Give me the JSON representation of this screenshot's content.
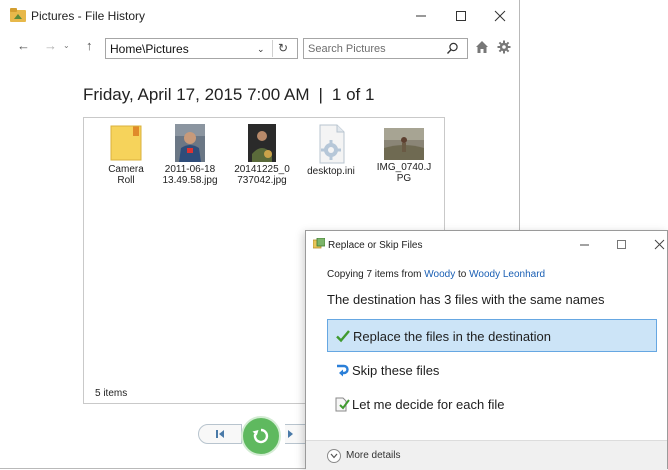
{
  "window": {
    "title": "Pictures - File History",
    "controls": {
      "minimize": "—",
      "maximize": "☐",
      "close": "✕"
    }
  },
  "toolbar": {
    "back": "←",
    "forward": "→",
    "recent": "⌄",
    "up": "↑",
    "address": "Home\\Pictures",
    "address_dropdown": "⌄",
    "refresh": "↻",
    "search_placeholder": "Search Pictures",
    "search_icon": "search-icon",
    "home_icon": "home-icon",
    "settings_icon": "gear-icon"
  },
  "backup": {
    "date": "Friday, April 17, 2015 7:00 AM",
    "separator": "|",
    "position": "1 of 1"
  },
  "files": [
    {
      "name": "Camera\nRoll",
      "type": "folder",
      "icon": "folder-icon"
    },
    {
      "name": "2011-06-18\n13.49.58.jpg",
      "type": "image",
      "icon": "photo-thumbnail"
    },
    {
      "name": "20141225_0\n737042.jpg",
      "type": "image",
      "icon": "photo-thumbnail"
    },
    {
      "name": "desktop.ini",
      "type": "config",
      "icon": "settings-file-icon"
    },
    {
      "name": "IMG_0740.J\nPG",
      "type": "image",
      "icon": "photo-thumbnail"
    }
  ],
  "status": {
    "items": "5 items"
  },
  "playback": {
    "previous_icon": "previous-version-icon",
    "restore_icon": "restore-icon",
    "next_icon": "next-version-icon",
    "restore_color": "#5fb95f"
  },
  "dialog": {
    "title": "Replace or Skip Files",
    "controls": {
      "minimize": "—",
      "maximize": "☐",
      "close": "✕"
    },
    "copying": {
      "prefix": "Copying 7 items from ",
      "from": "Woody",
      "to_word": " to ",
      "to": "Woody Leonhard"
    },
    "message": "The destination has 3 files with the same names",
    "options": [
      {
        "label": "Replace the files in the destination",
        "icon": "checkmark-icon",
        "selected": true
      },
      {
        "label": "Skip these files",
        "icon": "skip-arrow-icon",
        "selected": false
      },
      {
        "label": "Let me decide for each file",
        "icon": "decide-file-icon",
        "selected": false
      }
    ],
    "more_details": "More details",
    "link_color": "#1a5fb4",
    "selection_color": "#cce4f7"
  }
}
